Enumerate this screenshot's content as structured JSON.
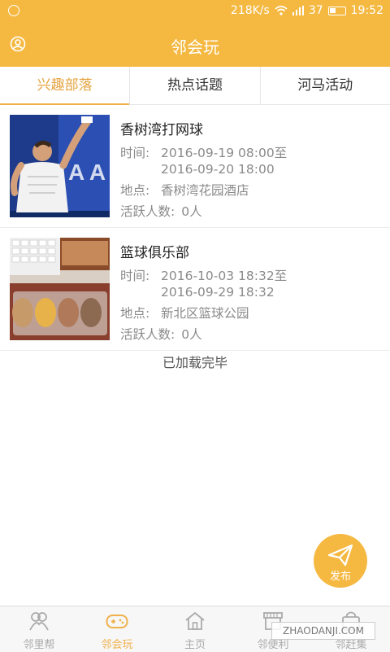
{
  "status": {
    "speed": "218K/s",
    "battery": "37",
    "time": "19:52"
  },
  "header": {
    "title": "邻会玩"
  },
  "tabs": [
    {
      "label": "兴趣部落",
      "active": true
    },
    {
      "label": "热点话题",
      "active": false
    },
    {
      "label": "河马活动",
      "active": false
    }
  ],
  "items": [
    {
      "name": "香树湾打网球",
      "time_label": "时间:",
      "time_line1": "2016-09-19 08:00至",
      "time_line2": "2016-09-20 18:00",
      "place_label": "地点:",
      "place": "香树湾花园酒店",
      "active_label": "活跃人数:",
      "active_count": "0人"
    },
    {
      "name": "篮球俱乐部",
      "time_label": "时间:",
      "time_line1": "2016-10-03 18:32至",
      "time_line2": "2016-09-29 18:32",
      "place_label": "地点:",
      "place": "新北区篮球公园",
      "active_label": "活跃人数:",
      "active_count": "0人"
    }
  ],
  "footer_text": "已加载完毕",
  "fab": {
    "label": "发布"
  },
  "bottom_nav": [
    {
      "label": "邻里帮",
      "icon": "people-icon",
      "active": false
    },
    {
      "label": "邻会玩",
      "icon": "gamepad-icon",
      "active": true
    },
    {
      "label": "主页",
      "icon": "home-icon",
      "active": false
    },
    {
      "label": "邻便利",
      "icon": "shop-icon",
      "active": false
    },
    {
      "label": "邻赶集",
      "icon": "bag-icon",
      "active": false
    }
  ],
  "watermark": "ZHAODANJI.COM",
  "colors": {
    "accent": "#f5b942",
    "tab_active": "#e5a340"
  }
}
